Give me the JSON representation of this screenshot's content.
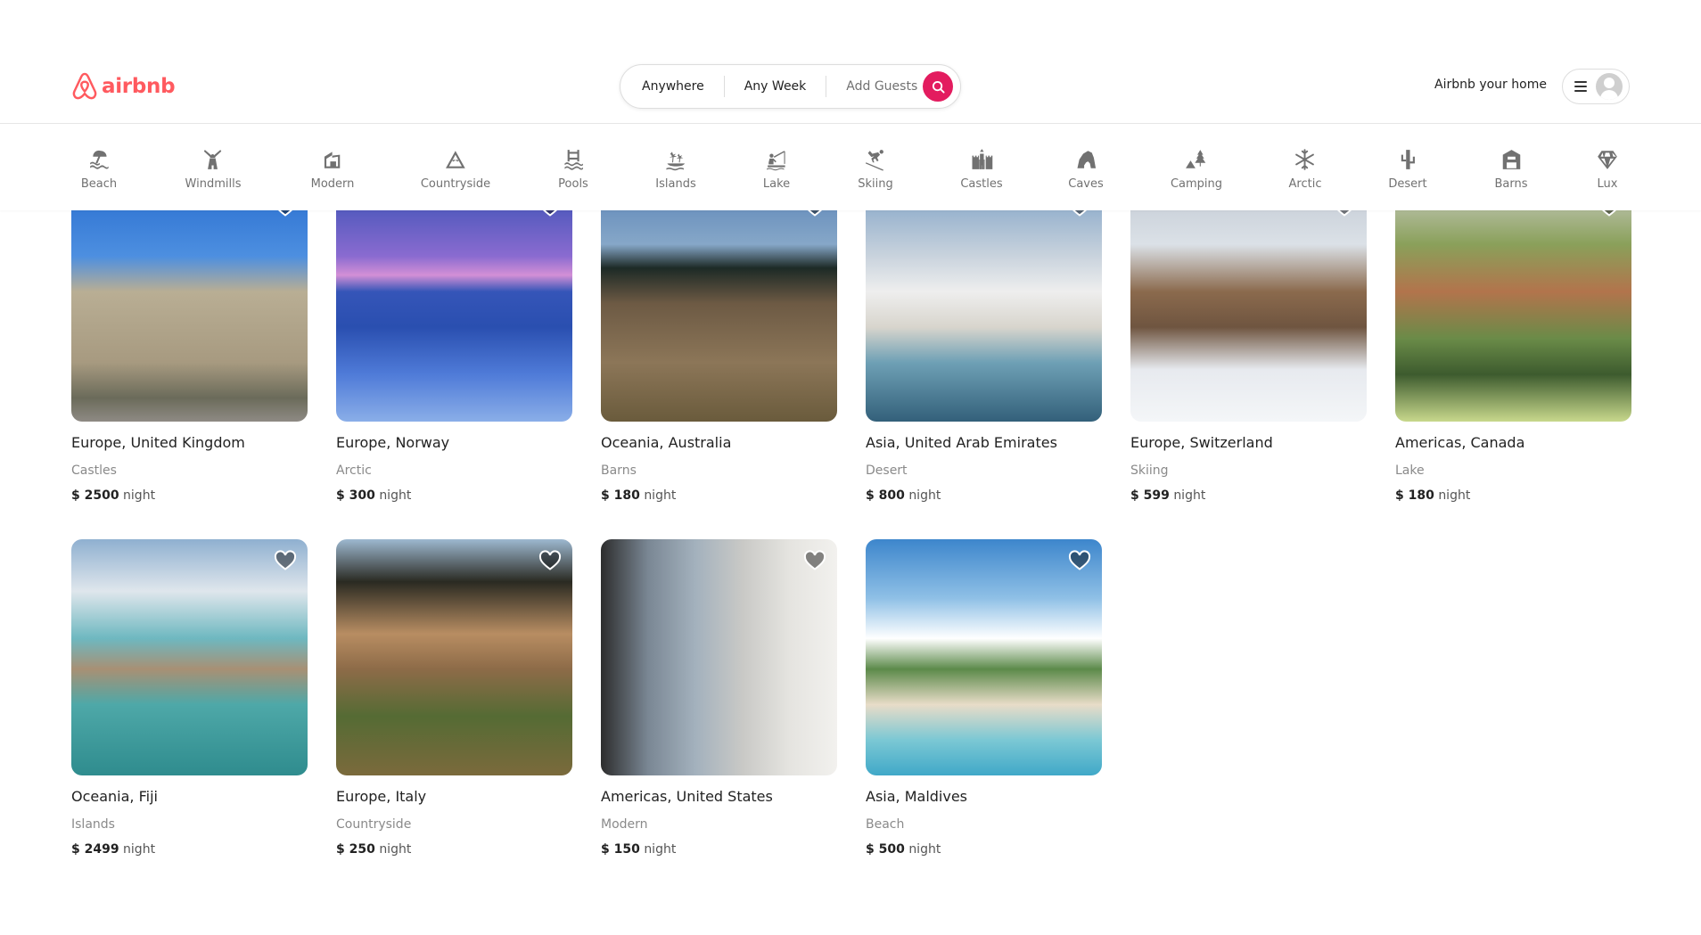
{
  "header": {
    "logo_text": "airbnb",
    "brand_color": "#FF5A5F",
    "search": {
      "anywhere": "Anywhere",
      "any_week": "Any Week",
      "add_guests": "Add Guests",
      "button_color": "#E31C5F",
      "button_icon": "search-icon"
    },
    "host_link": "Airbnb your home",
    "menu_icon": "hamburger-icon",
    "avatar_icon": "user-avatar-icon"
  },
  "categories": [
    {
      "label": "Beach",
      "icon": "beach-umbrella-icon"
    },
    {
      "label": "Windmills",
      "icon": "windmill-icon"
    },
    {
      "label": "Modern",
      "icon": "modern-house-icon"
    },
    {
      "label": "Countryside",
      "icon": "mountain-icon"
    },
    {
      "label": "Pools",
      "icon": "pool-ladder-icon"
    },
    {
      "label": "Islands",
      "icon": "island-palm-icon"
    },
    {
      "label": "Lake",
      "icon": "fishing-icon"
    },
    {
      "label": "Skiing",
      "icon": "skier-icon"
    },
    {
      "label": "Castles",
      "icon": "castle-icon"
    },
    {
      "label": "Caves",
      "icon": "cave-icon"
    },
    {
      "label": "Camping",
      "icon": "tent-tree-icon"
    },
    {
      "label": "Arctic",
      "icon": "snowflake-icon"
    },
    {
      "label": "Desert",
      "icon": "cactus-icon"
    },
    {
      "label": "Barns",
      "icon": "barn-icon"
    },
    {
      "label": "Lux",
      "icon": "diamond-icon"
    }
  ],
  "listings": [
    {
      "location": "Europe, United Kingdom",
      "category": "Castles",
      "currency": "$",
      "price": "2500",
      "unit": "night"
    },
    {
      "location": "Europe, Norway",
      "category": "Arctic",
      "currency": "$",
      "price": "300",
      "unit": "night"
    },
    {
      "location": "Oceania, Australia",
      "category": "Barns",
      "currency": "$",
      "price": "180",
      "unit": "night"
    },
    {
      "location": "Asia, United Arab Emirates",
      "category": "Desert",
      "currency": "$",
      "price": "800",
      "unit": "night"
    },
    {
      "location": "Europe, Switzerland",
      "category": "Skiing",
      "currency": "$",
      "price": "599",
      "unit": "night"
    },
    {
      "location": "Americas, Canada",
      "category": "Lake",
      "currency": "$",
      "price": "180",
      "unit": "night"
    },
    {
      "location": "Oceania, Fiji",
      "category": "Islands",
      "currency": "$",
      "price": "2499",
      "unit": "night"
    },
    {
      "location": "Europe, Italy",
      "category": "Countryside",
      "currency": "$",
      "price": "250",
      "unit": "night"
    },
    {
      "location": "Americas, United States",
      "category": "Modern",
      "currency": "$",
      "price": "150",
      "unit": "night"
    },
    {
      "location": "Asia, Maldives",
      "category": "Beach",
      "currency": "$",
      "price": "500",
      "unit": "night"
    }
  ]
}
